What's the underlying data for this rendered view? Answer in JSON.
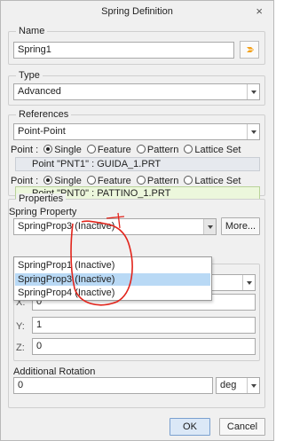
{
  "window": {
    "title": "Spring Definition",
    "close_glyph": "×"
  },
  "name_group": {
    "legend": "Name",
    "value": "Spring1"
  },
  "type_group": {
    "legend": "Type",
    "value": "Advanced"
  },
  "references_group": {
    "legend": "References",
    "reference_type": "Point-Point",
    "point_label": "Point :",
    "options": [
      "Single",
      "Feature",
      "Pattern",
      "Lattice Set"
    ],
    "point1": "Point \"PNT1\" : GUIDA_1.PRT",
    "point2": "Point \"PNT0\" : PATTINO_1.PRT"
  },
  "properties_group": {
    "legend": "Properties",
    "spring_property_label": "Spring Property",
    "selected_value": "SpringProp3 (Inactive)",
    "more_button": "More...",
    "dropdown_options": [
      "SpringProp1 (Inactive)",
      "SpringProp3 (Inactive)",
      "SpringProp4 (Inactive)"
    ],
    "x_label": "X:",
    "x_value": "0",
    "y_label": "Y:",
    "y_value": "1",
    "z_label": "Z:",
    "z_value": "0",
    "additional_rotation_label": "Additional Rotation",
    "rotation_value": "0",
    "rotation_unit": "deg"
  },
  "footer": {
    "ok": "OK",
    "cancel": "Cancel"
  },
  "colors": {
    "accent": "#f3a018",
    "annotation_red": "#e2241b",
    "highlight": "#b9d9f5"
  },
  "icons": {
    "name_action": "orange-arrows-icon"
  }
}
